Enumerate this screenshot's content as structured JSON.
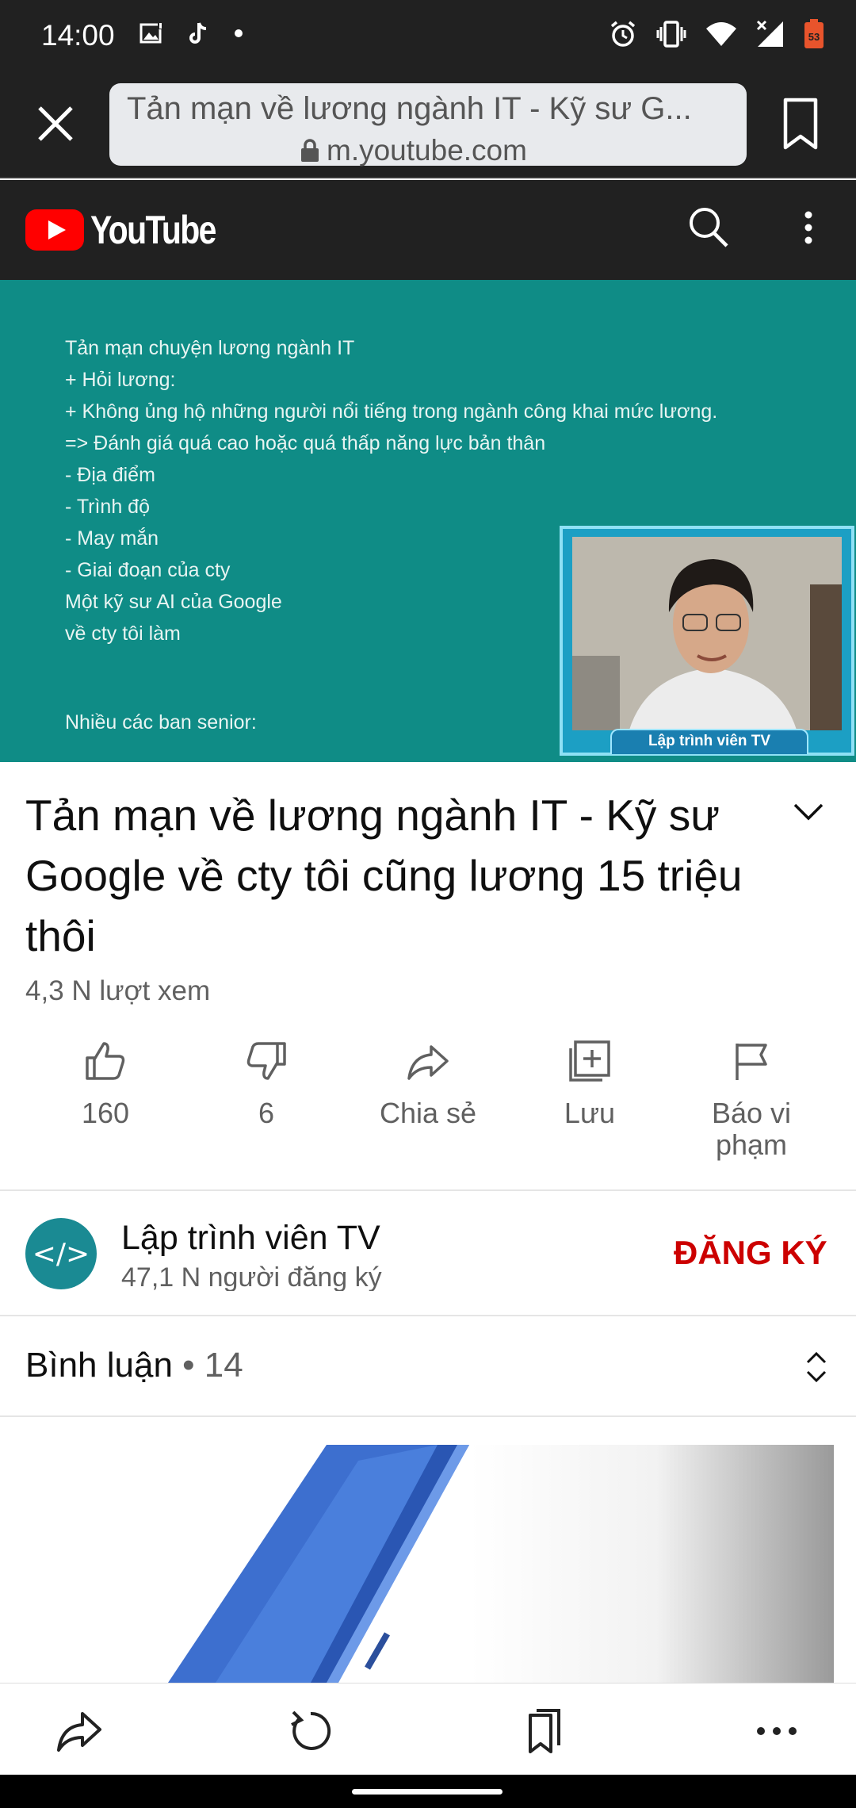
{
  "status_bar": {
    "time": "14:00",
    "battery_level": "53"
  },
  "browser": {
    "page_title": "Tản mạn về lương ngành IT - Kỹ sư G...",
    "domain": "m.youtube.com"
  },
  "youtube_header": {
    "logo_text": "YouTube",
    "brand_color": "#ff0000"
  },
  "video": {
    "text_lines": [
      "Tản mạn chuyện lương ngành IT",
      "+ Hỏi lương:",
      "+ Không ủng hộ những người nổi tiếng trong ngành công khai mức lương.",
      "=> Đánh giá quá cao hoặc quá thấp năng lực bản thân",
      "- Địa điểm",
      "- Trình độ",
      "- May mắn",
      "- Giai đoạn của cty",
      "Một kỹ sư AI của Google",
      "về cty tôi làm"
    ],
    "footer_line": "Nhiều các ban senior:",
    "webcam_label": "Lập trình viên TV"
  },
  "title": "Tản mạn về lương ngành IT - Kỹ sư Google về cty tôi cũng lương 15 triệu thôi",
  "views": "4,3 N lượt xem",
  "actions": [
    {
      "icon": "thumbs-up-icon",
      "label": "160"
    },
    {
      "icon": "thumbs-down-icon",
      "label": "6"
    },
    {
      "icon": "share-icon",
      "label": "Chia sẻ"
    },
    {
      "icon": "add-to-playlist-icon",
      "label": "Lưu"
    },
    {
      "icon": "flag-icon",
      "label": "Báo vi phạm"
    }
  ],
  "channel": {
    "avatar_text": "</>",
    "name": "Lập trình viên TV",
    "subscribers": "47,1 N người đăng ký",
    "subscribe_label": "ĐĂNG KÝ"
  },
  "comments": {
    "label": "Bình luận",
    "separator": " • ",
    "count": "14"
  }
}
